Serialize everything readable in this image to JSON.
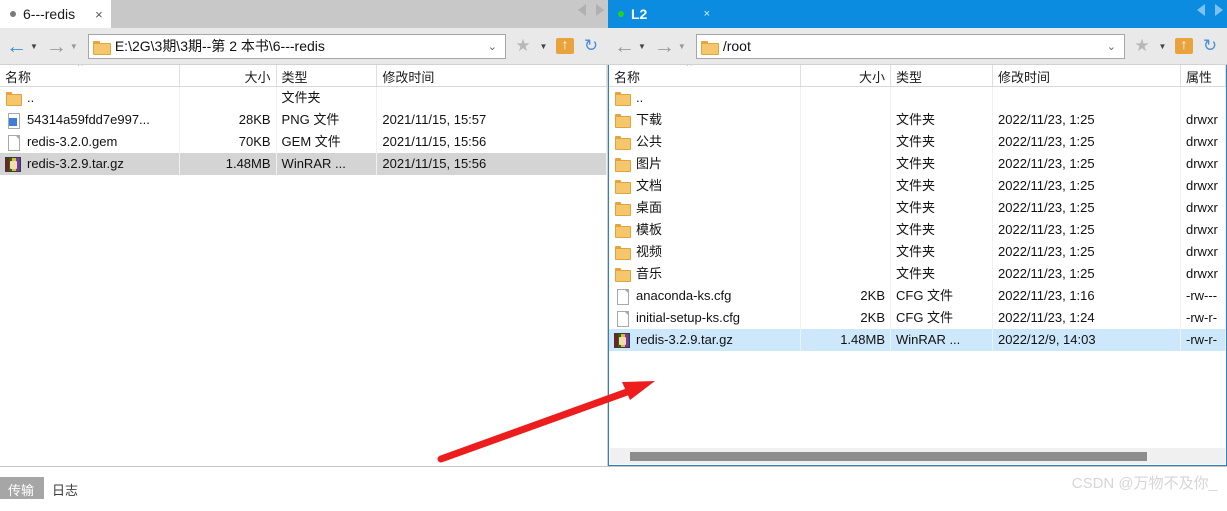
{
  "left_panel": {
    "tab": {
      "label": "6---redis",
      "close": "×",
      "status_dot": "idle"
    },
    "tabnav": {
      "prev": "◀",
      "next": "▶"
    },
    "toolbar": {
      "back": "←",
      "back_caret": "▼",
      "forward": "→",
      "forward_caret": "▼",
      "address": "E:\\2G\\3期\\3期--第 2 本书\\6---redis",
      "address_caret": "⌄",
      "star": "★",
      "star_caret": "▼",
      "home": "home-up",
      "refresh": "↻"
    },
    "columns": [
      "名称",
      "大小",
      "类型",
      "修改时间"
    ],
    "rows": [
      {
        "icon": "folder",
        "name": "..",
        "size": "",
        "type": "文件夹",
        "modified": "",
        "selected": false
      },
      {
        "icon": "png",
        "name": "54314a59fdd7e997...",
        "size": "28KB",
        "type": "PNG 文件",
        "modified": "2021/11/15, 15:57",
        "selected": false
      },
      {
        "icon": "doc",
        "name": "redis-3.2.0.gem",
        "size": "70KB",
        "type": "GEM 文件",
        "modified": "2021/11/15, 15:56",
        "selected": false
      },
      {
        "icon": "rar",
        "name": "redis-3.2.9.tar.gz",
        "size": "1.48MB",
        "type": "WinRAR ...",
        "modified": "2021/11/15, 15:56",
        "selected": true
      }
    ]
  },
  "right_panel": {
    "tab": {
      "label": "L2",
      "close": "×",
      "status_dot": "connected"
    },
    "tabnav": {
      "prev": "◀",
      "next": "▶"
    },
    "toolbar": {
      "back": "←",
      "back_caret": "▼",
      "forward": "→",
      "forward_caret": "▼",
      "address": "/root",
      "address_caret": "⌄",
      "star": "★",
      "star_caret": "▼",
      "home": "home-up",
      "refresh": "↻"
    },
    "columns": [
      "名称",
      "大小",
      "类型",
      "修改时间",
      "属性"
    ],
    "rows": [
      {
        "icon": "folder",
        "name": "..",
        "size": "",
        "type": "",
        "modified": "",
        "attrs": "",
        "selected": false
      },
      {
        "icon": "folder",
        "name": "下载",
        "size": "",
        "type": "文件夹",
        "modified": "2022/11/23, 1:25",
        "attrs": "drwxr",
        "selected": false
      },
      {
        "icon": "folder",
        "name": "公共",
        "size": "",
        "type": "文件夹",
        "modified": "2022/11/23, 1:25",
        "attrs": "drwxr",
        "selected": false
      },
      {
        "icon": "folder",
        "name": "图片",
        "size": "",
        "type": "文件夹",
        "modified": "2022/11/23, 1:25",
        "attrs": "drwxr",
        "selected": false
      },
      {
        "icon": "folder",
        "name": "文档",
        "size": "",
        "type": "文件夹",
        "modified": "2022/11/23, 1:25",
        "attrs": "drwxr",
        "selected": false
      },
      {
        "icon": "folder",
        "name": "桌面",
        "size": "",
        "type": "文件夹",
        "modified": "2022/11/23, 1:25",
        "attrs": "drwxr",
        "selected": false
      },
      {
        "icon": "folder",
        "name": "模板",
        "size": "",
        "type": "文件夹",
        "modified": "2022/11/23, 1:25",
        "attrs": "drwxr",
        "selected": false
      },
      {
        "icon": "folder",
        "name": "视频",
        "size": "",
        "type": "文件夹",
        "modified": "2022/11/23, 1:25",
        "attrs": "drwxr",
        "selected": false
      },
      {
        "icon": "folder",
        "name": "音乐",
        "size": "",
        "type": "文件夹",
        "modified": "2022/11/23, 1:25",
        "attrs": "drwxr",
        "selected": false
      },
      {
        "icon": "doc",
        "name": "anaconda-ks.cfg",
        "size": "2KB",
        "type": "CFG 文件",
        "modified": "2022/11/23, 1:16",
        "attrs": "-rw---",
        "selected": false
      },
      {
        "icon": "doc",
        "name": "initial-setup-ks.cfg",
        "size": "2KB",
        "type": "CFG 文件",
        "modified": "2022/11/23, 1:24",
        "attrs": "-rw-r-",
        "selected": false
      },
      {
        "icon": "rar",
        "name": "redis-3.2.9.tar.gz",
        "size": "1.48MB",
        "type": "WinRAR ...",
        "modified": "2022/12/9, 14:03",
        "attrs": "-rw-r-",
        "selected": true
      }
    ]
  },
  "statusbar": {
    "tabs": [
      {
        "label": "传输",
        "active": true
      },
      {
        "label": "日志",
        "active": false
      }
    ]
  },
  "watermark": {
    "text": "CSDN @万物不及你_"
  },
  "annotation": {
    "color": "#ee1d1d",
    "kind": "arrow-pointing-up-right"
  }
}
